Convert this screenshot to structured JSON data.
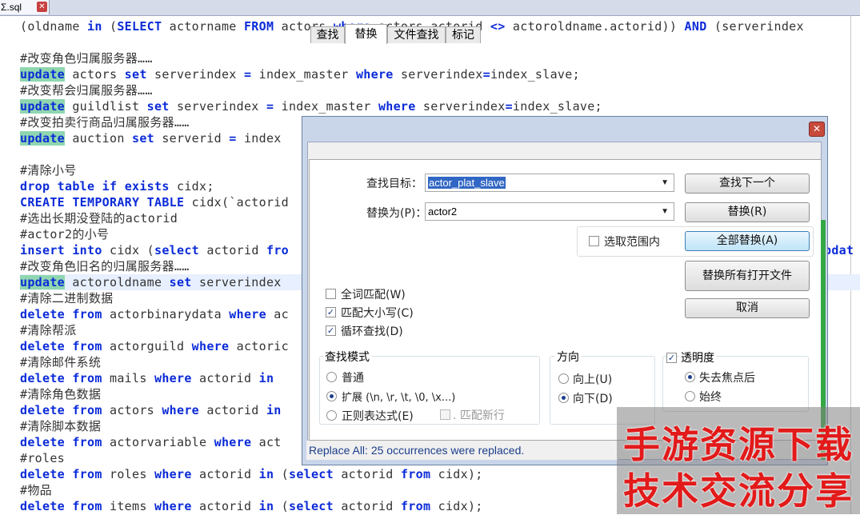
{
  "editor": {
    "tab_name": "Σ.sql",
    "lines": [
      [
        {
          "t": "(oldname ",
          "k": "tx"
        },
        {
          "t": "in",
          "k": "kw"
        },
        {
          "t": " (",
          "k": "tx"
        },
        {
          "t": "SELECT",
          "k": "kw"
        },
        {
          "t": " actorname ",
          "k": "tx"
        },
        {
          "t": "FROM",
          "k": "kw"
        },
        {
          "t": " actors ",
          "k": "tx"
        },
        {
          "t": "where",
          "k": "kw"
        },
        {
          "t": " actors.actorid ",
          "k": "tx"
        },
        {
          "t": "<>",
          "k": "kw"
        },
        {
          "t": " actoroldname.actorid)) ",
          "k": "tx"
        },
        {
          "t": "AND",
          "k": "kw"
        },
        {
          "t": " (serverindex",
          "k": "tx"
        }
      ],
      [],
      [
        {
          "t": "#改变角色归属服务器……",
          "k": "cm"
        }
      ],
      [
        {
          "t": "update",
          "k": "kwh"
        },
        {
          "t": " actors ",
          "k": "tx"
        },
        {
          "t": "set",
          "k": "kw"
        },
        {
          "t": " serverindex ",
          "k": "tx"
        },
        {
          "t": "=",
          "k": "kw"
        },
        {
          "t": " index_master ",
          "k": "tx"
        },
        {
          "t": "where",
          "k": "kw"
        },
        {
          "t": " serverindex",
          "k": "tx"
        },
        {
          "t": "=",
          "k": "kw"
        },
        {
          "t": "index_slave;",
          "k": "tx"
        }
      ],
      [
        {
          "t": "#改变帮会归属服务器……",
          "k": "cm"
        }
      ],
      [
        {
          "t": "update",
          "k": "kwh"
        },
        {
          "t": " guildlist ",
          "k": "tx"
        },
        {
          "t": "set",
          "k": "kw"
        },
        {
          "t": " serverindex ",
          "k": "tx"
        },
        {
          "t": "=",
          "k": "kw"
        },
        {
          "t": " index_master ",
          "k": "tx"
        },
        {
          "t": "where",
          "k": "kw"
        },
        {
          "t": " serverindex",
          "k": "tx"
        },
        {
          "t": "=",
          "k": "kw"
        },
        {
          "t": "index_slave;",
          "k": "tx"
        }
      ],
      [
        {
          "t": "#改变拍卖行商品归属服务器……",
          "k": "cm"
        }
      ],
      [
        {
          "t": "update",
          "k": "kwh"
        },
        {
          "t": " auction ",
          "k": "tx"
        },
        {
          "t": "set",
          "k": "kw"
        },
        {
          "t": " serverid ",
          "k": "tx"
        },
        {
          "t": "=",
          "k": "kw"
        },
        {
          "t": " index",
          "k": "tx"
        }
      ],
      [],
      [
        {
          "t": "#清除小号",
          "k": "cm"
        }
      ],
      [
        {
          "t": "drop",
          "k": "kw"
        },
        {
          "t": " ",
          "k": "tx"
        },
        {
          "t": "table",
          "k": "kw"
        },
        {
          "t": " ",
          "k": "tx"
        },
        {
          "t": "if",
          "k": "kw"
        },
        {
          "t": " ",
          "k": "tx"
        },
        {
          "t": "exists",
          "k": "kw"
        },
        {
          "t": " cidx;",
          "k": "tx"
        }
      ],
      [
        {
          "t": "CREATE",
          "k": "kw"
        },
        {
          "t": " ",
          "k": "tx"
        },
        {
          "t": "TEMPORARY",
          "k": "kw"
        },
        {
          "t": " ",
          "k": "tx"
        },
        {
          "t": "TABLE",
          "k": "kw"
        },
        {
          "t": " cidx(`actorid",
          "k": "tx"
        }
      ],
      [
        {
          "t": "#选出长期没登陆的actorid",
          "k": "cm"
        }
      ],
      [
        {
          "t": "#actor2的小号",
          "k": "cm"
        }
      ],
      [
        {
          "t": "insert",
          "k": "kw"
        },
        {
          "t": " ",
          "k": "tx"
        },
        {
          "t": "into",
          "k": "kw"
        },
        {
          "t": " cidx (",
          "k": "tx"
        },
        {
          "t": "select",
          "k": "kw"
        },
        {
          "t": " actorid ",
          "k": "tx"
        },
        {
          "t": "fro",
          "k": "kw"
        }
      ],
      [
        {
          "t": "#改变角色旧名的归属服务器……",
          "k": "cm"
        }
      ],
      [
        {
          "t": "update",
          "k": "kwh"
        },
        {
          "t": " actoroldname ",
          "k": "tx"
        },
        {
          "t": "set",
          "k": "kw"
        },
        {
          "t": " serverindex",
          "k": "tx"
        }
      ],
      [
        {
          "t": "#清除二进制数据",
          "k": "cm"
        }
      ],
      [
        {
          "t": "delete",
          "k": "kw"
        },
        {
          "t": " ",
          "k": "tx"
        },
        {
          "t": "from",
          "k": "kw"
        },
        {
          "t": " actorbinarydata ",
          "k": "tx"
        },
        {
          "t": "where",
          "k": "kw"
        },
        {
          "t": " ac",
          "k": "tx"
        }
      ],
      [
        {
          "t": "#清除帮派",
          "k": "cm"
        }
      ],
      [
        {
          "t": "delete",
          "k": "kw"
        },
        {
          "t": " ",
          "k": "tx"
        },
        {
          "t": "from",
          "k": "kw"
        },
        {
          "t": " actorguild ",
          "k": "tx"
        },
        {
          "t": "where",
          "k": "kw"
        },
        {
          "t": " actoric",
          "k": "tx"
        }
      ],
      [
        {
          "t": "#清除邮件系统",
          "k": "cm"
        }
      ],
      [
        {
          "t": "delete",
          "k": "kw"
        },
        {
          "t": " ",
          "k": "tx"
        },
        {
          "t": "from",
          "k": "kw"
        },
        {
          "t": " mails ",
          "k": "tx"
        },
        {
          "t": "where",
          "k": "kw"
        },
        {
          "t": " actorid ",
          "k": "tx"
        },
        {
          "t": "in",
          "k": "kw"
        }
      ],
      [
        {
          "t": "#清除角色数据",
          "k": "cm"
        }
      ],
      [
        {
          "t": "delete",
          "k": "kw"
        },
        {
          "t": " ",
          "k": "tx"
        },
        {
          "t": "from",
          "k": "kw"
        },
        {
          "t": " actors ",
          "k": "tx"
        },
        {
          "t": "where",
          "k": "kw"
        },
        {
          "t": " actorid ",
          "k": "tx"
        },
        {
          "t": "in",
          "k": "kw"
        }
      ],
      [
        {
          "t": "#清除脚本数据",
          "k": "cm"
        }
      ],
      [
        {
          "t": "delete",
          "k": "kw"
        },
        {
          "t": " ",
          "k": "tx"
        },
        {
          "t": "from",
          "k": "kw"
        },
        {
          "t": " actorvariable ",
          "k": "tx"
        },
        {
          "t": "where",
          "k": "kw"
        },
        {
          "t": " act",
          "k": "tx"
        }
      ],
      [
        {
          "t": "#roles",
          "k": "cm"
        }
      ],
      [
        {
          "t": "delete",
          "k": "kw"
        },
        {
          "t": " ",
          "k": "tx"
        },
        {
          "t": "from",
          "k": "kw"
        },
        {
          "t": " roles ",
          "k": "tx"
        },
        {
          "t": "where",
          "k": "kw"
        },
        {
          "t": " actorid ",
          "k": "tx"
        },
        {
          "t": "in",
          "k": "kw"
        },
        {
          "t": " (",
          "k": "tx"
        },
        {
          "t": "select",
          "k": "kw"
        },
        {
          "t": " actorid ",
          "k": "tx"
        },
        {
          "t": "from",
          "k": "kw"
        },
        {
          "t": " cidx);",
          "k": "tx"
        }
      ],
      [
        {
          "t": "#物品",
          "k": "cm"
        }
      ],
      [
        {
          "t": "delete",
          "k": "kw"
        },
        {
          "t": " ",
          "k": "tx"
        },
        {
          "t": "from",
          "k": "kw"
        },
        {
          "t": " items ",
          "k": "tx"
        },
        {
          "t": "where",
          "k": "kw"
        },
        {
          "t": " actorid ",
          "k": "tx"
        },
        {
          "t": "in",
          "k": "kw"
        },
        {
          "t": " (",
          "k": "tx"
        },
        {
          "t": "select",
          "k": "kw"
        },
        {
          "t": " actorid ",
          "k": "tx"
        },
        {
          "t": "from",
          "k": "kw"
        },
        {
          "t": " cidx);",
          "k": "tx"
        }
      ]
    ],
    "right_overflow": {
      "line14": "pdat"
    }
  },
  "dialog": {
    "close_glyph": "✕",
    "tabs": [
      {
        "label": "查找",
        "active": false
      },
      {
        "label": "替换",
        "active": true
      },
      {
        "label": "文件查找",
        "active": false
      },
      {
        "label": "标记",
        "active": false
      }
    ],
    "find_label": "查找目标：",
    "find_value": "actor_plat_slave",
    "replace_label": "替换为(P)：",
    "replace_value": "actor2",
    "buttons": {
      "find_next": "查找下一个",
      "replace": "替换(R)",
      "replace_all": "全部替换(A)",
      "replace_all_open": "替换所有打开文件",
      "cancel": "取消"
    },
    "in_selection": {
      "label": "选取范围内",
      "checked": false
    },
    "options": [
      {
        "label": "全词匹配(W)",
        "checked": false
      },
      {
        "label": "匹配大小写(C)",
        "checked": true
      },
      {
        "label": "循环查找(D)",
        "checked": true
      }
    ],
    "search_mode": {
      "title": "查找模式",
      "options": [
        {
          "label": "普通",
          "selected": false
        },
        {
          "label": "扩展 (\\n, \\r, \\t, \\0, \\x...)",
          "selected": true
        },
        {
          "label": "正则表达式(E)",
          "selected": false
        }
      ],
      "match_newline": {
        "label": ". 匹配新行",
        "checked": false
      }
    },
    "direction": {
      "title": "方向",
      "options": [
        {
          "label": "向上(U)",
          "selected": false
        },
        {
          "label": "向下(D)",
          "selected": true
        }
      ]
    },
    "transparency": {
      "title": "透明度",
      "checked": true,
      "options": [
        {
          "label": "失去焦点后",
          "selected": true
        },
        {
          "label": "始终",
          "selected": false
        }
      ]
    },
    "status": "Replace All: 25 occurrences were replaced."
  },
  "watermark": {
    "line1": "手游资源下载",
    "line2": "技术交流分享"
  },
  "colors": {
    "keyword": "#0b2bd8",
    "highlight": "#8fd6b0",
    "watermark": "#e21a1a"
  }
}
